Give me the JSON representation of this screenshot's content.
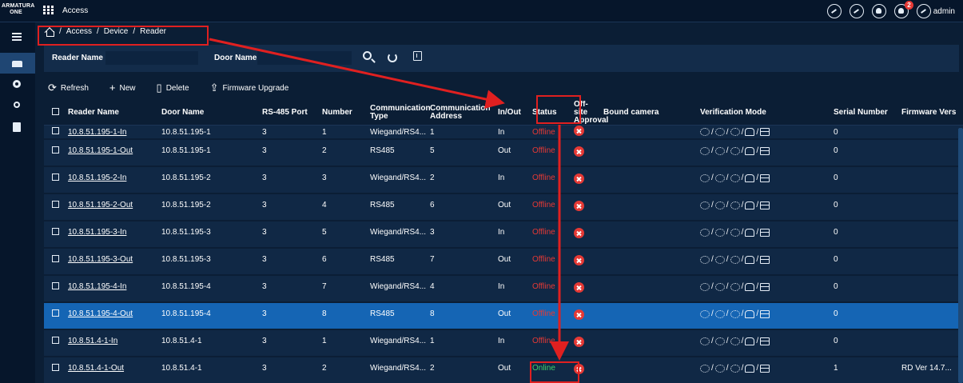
{
  "app": {
    "logo_line1": "ARMATURA",
    "logo_line2": "ONE",
    "title": "Access",
    "user": "admin",
    "notification_count": "2"
  },
  "breadcrumb": [
    "Access",
    "Device",
    "Reader"
  ],
  "filters": {
    "reader_name_label": "Reader Name",
    "reader_name_value": "",
    "door_name_label": "Door Name",
    "door_name_value": ""
  },
  "toolbar": {
    "refresh": "Refresh",
    "new": "New",
    "delete": "Delete",
    "firmware_upgrade": "Firmware Upgrade"
  },
  "columns": [
    {
      "label": "Reader Name"
    },
    {
      "label": "Door Name"
    },
    {
      "label": "RS-485 Port"
    },
    {
      "label": "Number"
    },
    {
      "label": "Communication Type"
    },
    {
      "label": "Communication Address"
    },
    {
      "label": "In/Out"
    },
    {
      "label": "Status"
    },
    {
      "label": "Off-site Approval"
    },
    {
      "label": "Bound camera"
    },
    {
      "label": "Verification Mode"
    },
    {
      "label": "Serial Number"
    },
    {
      "label": "Firmware Vers"
    }
  ],
  "rows": [
    {
      "reader": "10.8.51.195-1-In",
      "door": "10.8.51.195-1",
      "port": "3",
      "number": "1",
      "ctype": "Wiegand/RS4...",
      "caddr": "1",
      "inout": "In",
      "status": "Offline",
      "serial": "0",
      "firmware": ""
    },
    {
      "reader": "10.8.51.195-1-Out",
      "door": "10.8.51.195-1",
      "port": "3",
      "number": "2",
      "ctype": "RS485",
      "caddr": "5",
      "inout": "Out",
      "status": "Offline",
      "serial": "0",
      "firmware": ""
    },
    {
      "reader": "10.8.51.195-2-In",
      "door": "10.8.51.195-2",
      "port": "3",
      "number": "3",
      "ctype": "Wiegand/RS4...",
      "caddr": "2",
      "inout": "In",
      "status": "Offline",
      "serial": "0",
      "firmware": ""
    },
    {
      "reader": "10.8.51.195-2-Out",
      "door": "10.8.51.195-2",
      "port": "3",
      "number": "4",
      "ctype": "RS485",
      "caddr": "6",
      "inout": "Out",
      "status": "Offline",
      "serial": "0",
      "firmware": ""
    },
    {
      "reader": "10.8.51.195-3-In",
      "door": "10.8.51.195-3",
      "port": "3",
      "number": "5",
      "ctype": "Wiegand/RS4...",
      "caddr": "3",
      "inout": "In",
      "status": "Offline",
      "serial": "0",
      "firmware": ""
    },
    {
      "reader": "10.8.51.195-3-Out",
      "door": "10.8.51.195-3",
      "port": "3",
      "number": "6",
      "ctype": "RS485",
      "caddr": "7",
      "inout": "Out",
      "status": "Offline",
      "serial": "0",
      "firmware": ""
    },
    {
      "reader": "10.8.51.195-4-In",
      "door": "10.8.51.195-4",
      "port": "3",
      "number": "7",
      "ctype": "Wiegand/RS4...",
      "caddr": "4",
      "inout": "In",
      "status": "Offline",
      "serial": "0",
      "firmware": ""
    },
    {
      "reader": "10.8.51.195-4-Out",
      "door": "10.8.51.195-4",
      "port": "3",
      "number": "8",
      "ctype": "RS485",
      "caddr": "8",
      "inout": "Out",
      "status": "Offline",
      "serial": "0",
      "firmware": ""
    },
    {
      "reader": "10.8.51.4-1-In",
      "door": "10.8.51.4-1",
      "port": "3",
      "number": "1",
      "ctype": "Wiegand/RS4...",
      "caddr": "1",
      "inout": "In",
      "status": "Offline",
      "serial": "0",
      "firmware": ""
    },
    {
      "reader": "10.8.51.4-1-Out",
      "door": "10.8.51.4-1",
      "port": "3",
      "number": "2",
      "ctype": "Wiegand/RS4...",
      "caddr": "2",
      "inout": "Out",
      "status": "Online",
      "serial": "1",
      "firmware": "RD Ver 14.7..."
    }
  ],
  "selected_row_index": 7,
  "colors": {
    "offline": "#e53935",
    "online": "#3fd16b",
    "selected": "#1565b4",
    "annotation": "#e02020"
  }
}
